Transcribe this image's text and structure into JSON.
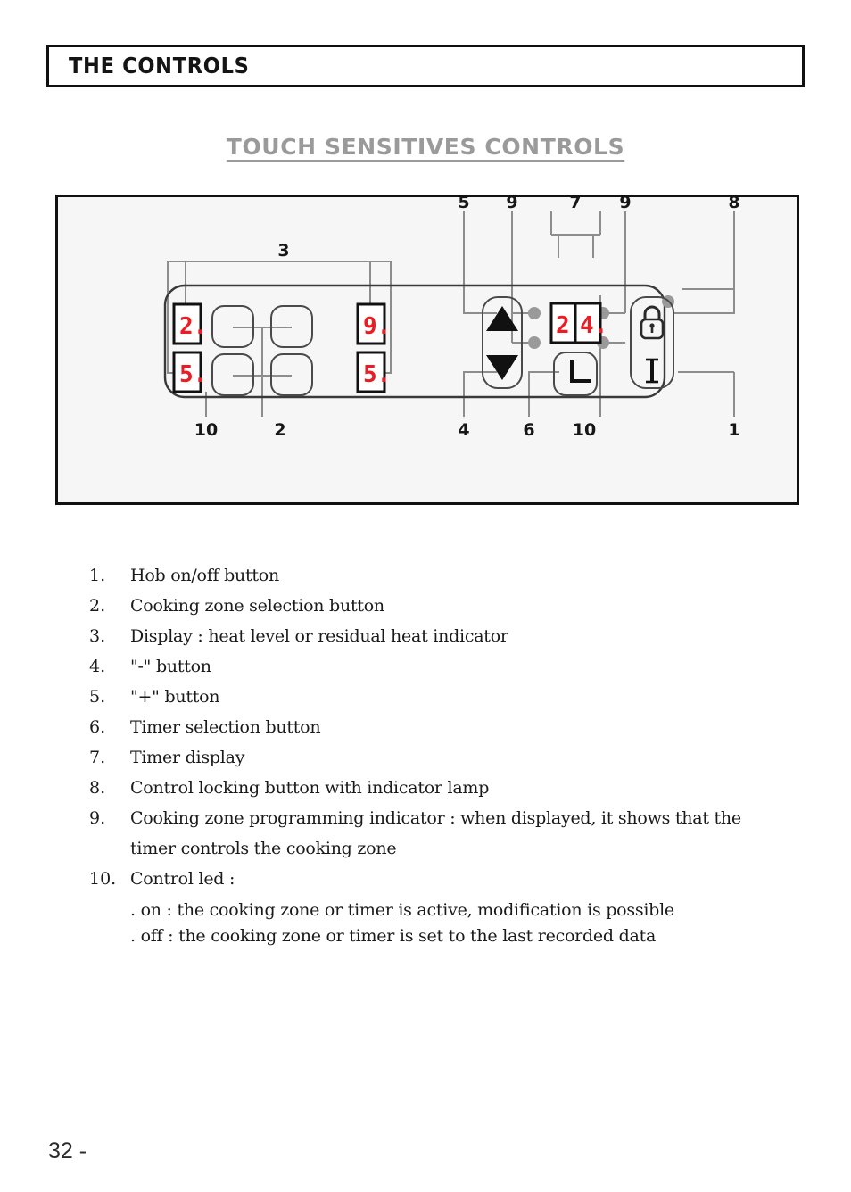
{
  "header": {
    "title": "THE CONTROLS"
  },
  "section": {
    "heading": "TOUCH SENSITIVES CONTROLS"
  },
  "figure": {
    "zone_displays": [
      {
        "name": "front-left-display",
        "value": "2."
      },
      {
        "name": "rear-left-display",
        "value": "5."
      },
      {
        "name": "front-right-display",
        "value": "9."
      },
      {
        "name": "rear-right-display",
        "value": "5."
      }
    ],
    "timer_display": {
      "digit_tens": "2",
      "digit_units": "4."
    },
    "button_icons": {
      "increase": "up-triangle",
      "decrease": "down-triangle",
      "timer_select": "clock-icon",
      "lock": "padlock-icon",
      "power": "power-icon"
    },
    "callouts_top": [
      {
        "label": "3"
      },
      {
        "label": "5"
      },
      {
        "label": "9"
      },
      {
        "label": "7"
      },
      {
        "label": "9"
      },
      {
        "label": "8"
      }
    ],
    "callouts_bottom": [
      {
        "label": "10"
      },
      {
        "label": "2"
      },
      {
        "label": "4"
      },
      {
        "label": "6"
      },
      {
        "label": "10"
      },
      {
        "label": "1"
      }
    ]
  },
  "legend": {
    "items": [
      {
        "num": "1.",
        "text": "Hob on/off button"
      },
      {
        "num": "2.",
        "text": "Cooking zone selection button"
      },
      {
        "num": "3.",
        "text": "Display : heat level or residual heat indicator"
      },
      {
        "num": "4.",
        "text": "\"-\" button"
      },
      {
        "num": "5.",
        "text": "\"+\" button"
      },
      {
        "num": "6.",
        "text": "Timer selection button"
      },
      {
        "num": "7.",
        "text": "Timer display"
      },
      {
        "num": "8.",
        "text": "Control locking button with indicator lamp"
      },
      {
        "num": "9.",
        "text": "Cooking zone programming indicator : when displayed, it shows that the"
      },
      {
        "num": "",
        "text": "timer controls the cooking zone",
        "continuation": true
      },
      {
        "num": "10.",
        "text": "Control led :"
      }
    ],
    "sub_lines": [
      ". on : the cooking zone or timer is active, modification is possible",
      ". off : the cooking zone or timer is set to the last recorded data"
    ]
  },
  "footer": {
    "page": "32 -"
  },
  "colors": {
    "segment_red": "#ec1c24",
    "heading_gray": "#9a9a9a",
    "leader_gray": "#8d8d8d",
    "ink": "#111111",
    "figure_bg": "#f5f6f5"
  }
}
